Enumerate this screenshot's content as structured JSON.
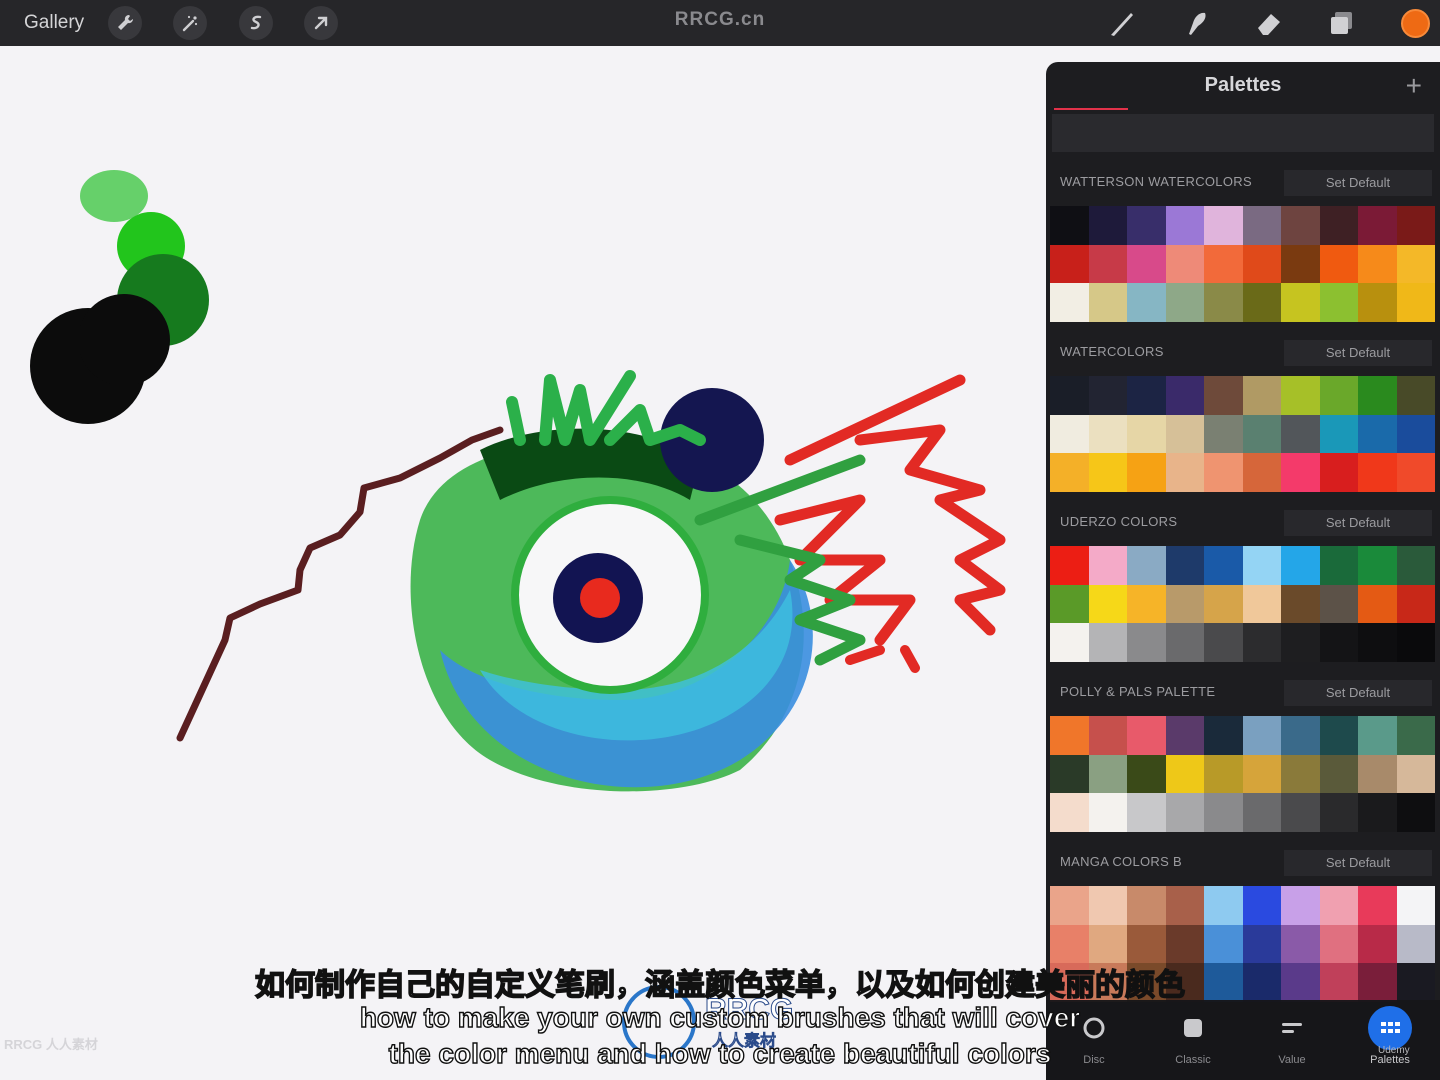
{
  "toolbar": {
    "gallery_label": "Gallery",
    "watermark": "RRCG.cn",
    "left_tools": [
      "wrench-icon",
      "magic-wand-icon",
      "selection-icon",
      "transform-arrow-icon"
    ],
    "right_tools": [
      "brush-icon",
      "smudge-icon",
      "eraser-icon",
      "layers-icon"
    ],
    "current_color": "#ee6a14"
  },
  "panel": {
    "title": "Palettes",
    "add_label": "+",
    "palettes": [
      {
        "name": "WATTERSON WATERCOLORS",
        "action": "Set Default",
        "swatches": [
          "#0f0f14",
          "#1e1a3a",
          "#382e6a",
          "#9b78d6",
          "#e0b4dc",
          "#7a6a82",
          "#6e4440",
          "#3e2024",
          "#7b1a36",
          "#7a1a18",
          "#c8201a",
          "#c73a48",
          "#d84a8a",
          "#ee8a78",
          "#f26a3a",
          "#e04a1a",
          "#7a3a10",
          "#f05a10",
          "#f68a1a",
          "#f4b828",
          "#f2eee4",
          "#d6c888",
          "#86b6c4",
          "#8ea888",
          "#8a8a48",
          "#6a6a18",
          "#c6c420",
          "#8cc030",
          "#b8900e",
          "#f0b818"
        ]
      },
      {
        "name": "WATERCOLORS",
        "action": "Set Default",
        "swatches": [
          "#1a1e28",
          "#222432",
          "#1c2444",
          "#3a2a6a",
          "#6e4a3a",
          "#b09a64",
          "#a6c028",
          "#6aa82a",
          "#2a8a1e",
          "#484a28",
          "#f0ece0",
          "#ebe0c0",
          "#e6d6a6",
          "#d6c098",
          "#7a8072",
          "#5a8070",
          "#52565a",
          "#1a98b8",
          "#1a6aaa",
          "#1a4c9c",
          "#f4b028",
          "#f6c618",
          "#f6a214",
          "#e8b48a",
          "#ef9470",
          "#d6663a",
          "#f43a6a",
          "#d81e1e",
          "#f0381a",
          "#f04a2a"
        ]
      },
      {
        "name": "UDERZO COLORS",
        "action": "Set Default",
        "swatches": [
          "#ec1e14",
          "#f4aac8",
          "#8aaac4",
          "#1e3a6a",
          "#1a5aa8",
          "#94d4f4",
          "#24a6e8",
          "#1a6a3a",
          "#1a8a3a",
          "#2a5a3a",
          "#5a9a28",
          "#f6d818",
          "#f6b428",
          "#b89a6a",
          "#d6a44a",
          "#f0c89a",
          "#6a4a2a",
          "#5c5248",
          "#e45a14",
          "#c82818",
          "#f4f2ee",
          "#b4b4b6",
          "#8a8a8c",
          "#6a6a6c",
          "#4a4a4c",
          "#2c2c2e",
          "#1e1e20",
          "#141416",
          "#0e0e10",
          "#0a0a0c"
        ]
      },
      {
        "name": "POLLY & PALS PALETTE",
        "action": "Set Default",
        "swatches": [
          "#f0762a",
          "#c6504c",
          "#e85a6a",
          "#5a3a6a",
          "#1a2a3a",
          "#7aa0c0",
          "#3a6a8a",
          "#1e4a4c",
          "#5a9a8a",
          "#3a6a4a",
          "#2a3a28",
          "#8aa082",
          "#3a4a18",
          "#eec818",
          "#b89a28",
          "#d6a43a",
          "#8a7a3a",
          "#5a5a3a",
          "#a88a6a",
          "#d6b89a",
          "#f4dccc",
          "#f4f2ee",
          "#c8c8ca",
          "#a8a8aa",
          "#8a8a8c",
          "#6a6a6c",
          "#4a4a4c",
          "#2a2a2c",
          "#1a1a1c",
          "#0e0e10"
        ]
      },
      {
        "name": "MANGA COLORS B",
        "action": "Set Default",
        "swatches": [
          "#eaa48a",
          "#f0c8b0",
          "#c88a6a",
          "#a8604a",
          "#8ecaf0",
          "#2a4ae0",
          "#c8a0e8",
          "#f0a0b0",
          "#e83a5a",
          "#f4f4f6",
          "#e88068",
          "#e0a880",
          "#9a5a3a",
          "#6a3a2a",
          "#4a90d8",
          "#2a3a9a",
          "#8a5aa8",
          "#e07080",
          "#b82a48",
          "#b8bac8",
          "#d86a5a",
          "#c87a5a",
          "#7a4a2a",
          "#4a2a1e",
          "#1e5a9a",
          "#1a2a6a",
          "#5a3a8a",
          "#c0405a",
          "#7a1e3a",
          "#1a1a22"
        ]
      }
    ],
    "nav": [
      {
        "label": "Disc",
        "icon": "disc-icon"
      },
      {
        "label": "Classic",
        "icon": "classic-square-icon"
      },
      {
        "label": "Value",
        "icon": "value-sliders-icon"
      },
      {
        "label": "Palettes",
        "icon": "palettes-grid-icon",
        "active": true
      }
    ]
  },
  "subtitles": {
    "cn": "如何制作自己的自定义笔刷，涵盖颜色菜单，以及如何创建美丽的颜色",
    "en_line1": "how to make your own custom brushes that will cover",
    "en_line2": "the color menu and how to create beautiful colors"
  },
  "overlays": {
    "corner_logo": "RRCG 人人素材",
    "center_logo_text": "RRCG",
    "center_logo_sub": "人人素材",
    "udemy": "Udemy"
  }
}
